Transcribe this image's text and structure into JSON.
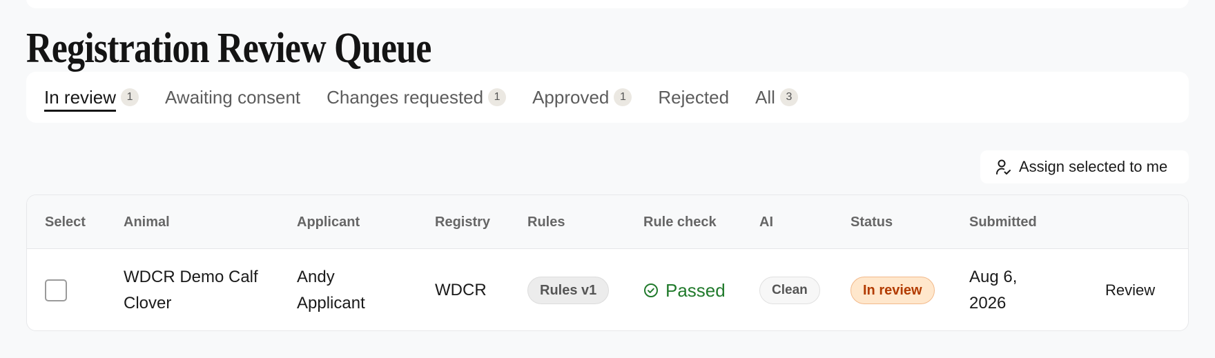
{
  "page": {
    "title": "Registration Review Queue"
  },
  "tabs": [
    {
      "label": "In review",
      "count": "1",
      "active": true
    },
    {
      "label": "Awaiting consent",
      "count": ""
    },
    {
      "label": "Changes requested",
      "count": "1"
    },
    {
      "label": "Approved",
      "count": "1"
    },
    {
      "label": "Rejected",
      "count": ""
    },
    {
      "label": "All",
      "count": "3"
    }
  ],
  "toolbar": {
    "assign_label": "Assign selected to me",
    "assign_icon": "user-check-icon"
  },
  "table": {
    "columns": [
      "Select",
      "Animal",
      "Applicant",
      "Registry",
      "Rules",
      "Rule check",
      "AI",
      "Status",
      "Submitted"
    ],
    "rows": [
      {
        "animal": "WDCR Demo Calf Clover",
        "applicant": "Andy Applicant",
        "registry": "WDCR",
        "rules": "Rules v1",
        "rule_check": "Passed",
        "ai": "Clean",
        "status": "In review",
        "submitted": "Aug 6, 2026",
        "action": "Review"
      }
    ]
  },
  "colors": {
    "passed": "#217a2c",
    "status_text": "#b23b00",
    "status_bg": "#ffe7cc",
    "count_badge_bg": "#ebe8e2"
  }
}
